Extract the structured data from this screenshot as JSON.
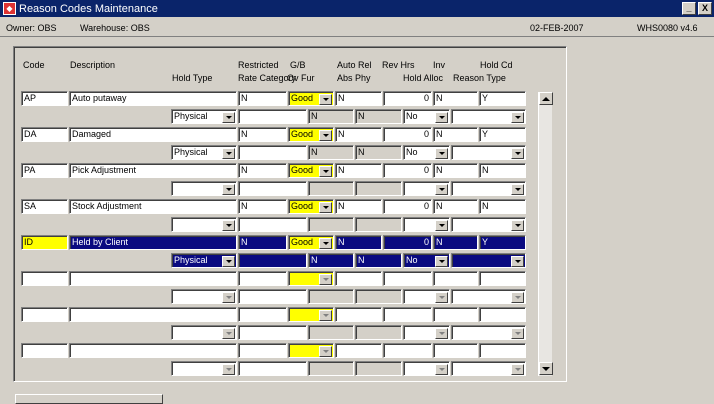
{
  "window": {
    "title": "Reason Codes Maintenance",
    "min_glyph": "_",
    "close_glyph": "X"
  },
  "info": {
    "owner": "Owner: OBS",
    "warehouse": "Warehouse: OBS",
    "date": "02-FEB-2007",
    "version": "WHS0080 v4.6"
  },
  "headers": {
    "code": "Code",
    "description": "Description",
    "hold_type": "Hold Type",
    "restricted_top": "Restricted",
    "restricted_bottom": "Rate Category",
    "gb_top": "G/B",
    "gb_bottom": "Ov Fur",
    "auto_rel_top": "Auto Rel",
    "auto_rel_bottom": "Abs Phy",
    "rev_hrs_top": "Rev Hrs",
    "rev_hrs_bottom": "Hold Alloc",
    "inv_top": "Inv",
    "inv_bottom": "Hold Cd",
    "hold_cd_top": "Hold Cd",
    "hold_cd_bottom": "Reason Type"
  },
  "rows": [
    {
      "code": "AP",
      "description": "Auto putaway",
      "restricted": "N",
      "gb": "Good",
      "auto_rel": "N",
      "rev_hrs": "0",
      "inv": "N",
      "hold_cd": "Y",
      "hold_type": "Physical",
      "ov_fur": "N",
      "abs_phy": "N",
      "hold_alloc": "No",
      "rate_category": "",
      "reason_type": ""
    },
    {
      "code": "DA",
      "description": "Damaged",
      "restricted": "N",
      "gb": "Good",
      "auto_rel": "N",
      "rev_hrs": "0",
      "inv": "N",
      "hold_cd": "Y",
      "hold_type": "Physical",
      "ov_fur": "N",
      "abs_phy": "N",
      "hold_alloc": "No",
      "rate_category": "",
      "reason_type": ""
    },
    {
      "code": "PA",
      "description": "Pick Adjustment",
      "restricted": "N",
      "gb": "Good",
      "auto_rel": "N",
      "rev_hrs": "0",
      "inv": "N",
      "hold_cd": "N",
      "hold_type": "",
      "ov_fur": "",
      "abs_phy": "",
      "hold_alloc": "",
      "rate_category": "",
      "reason_type": ""
    },
    {
      "code": "SA",
      "description": "Stock Adjustment",
      "restricted": "N",
      "gb": "Good",
      "auto_rel": "N",
      "rev_hrs": "0",
      "inv": "N",
      "hold_cd": "N",
      "hold_type": "",
      "ov_fur": "",
      "abs_phy": "",
      "hold_alloc": "",
      "rate_category": "",
      "reason_type": ""
    },
    {
      "code": "ID",
      "description": "Held by Client",
      "restricted": "N",
      "gb": "Good",
      "auto_rel": "N",
      "rev_hrs": "0",
      "inv": "N",
      "hold_cd": "Y",
      "hold_type": "Physical",
      "ov_fur": "N",
      "abs_phy": "N",
      "hold_alloc": "No",
      "rate_category": "",
      "reason_type": ""
    },
    {
      "code": "",
      "description": "",
      "restricted": "",
      "gb": "",
      "auto_rel": "",
      "rev_hrs": "",
      "inv": "",
      "hold_cd": "",
      "hold_type": "",
      "ov_fur": "",
      "abs_phy": "",
      "hold_alloc": "",
      "rate_category": "",
      "reason_type": ""
    },
    {
      "code": "",
      "description": "",
      "restricted": "",
      "gb": "",
      "auto_rel": "",
      "rev_hrs": "",
      "inv": "",
      "hold_cd": "",
      "hold_type": "",
      "ov_fur": "",
      "abs_phy": "",
      "hold_alloc": "",
      "rate_category": "",
      "reason_type": ""
    },
    {
      "code": "",
      "description": "",
      "restricted": "",
      "gb": "",
      "auto_rel": "",
      "rev_hrs": "",
      "inv": "",
      "hold_cd": "",
      "hold_type": "",
      "ov_fur": "",
      "abs_phy": "",
      "hold_alloc": "",
      "rate_category": "",
      "reason_type": ""
    }
  ],
  "colors": {
    "title_bar": "#0a246a",
    "selected_row": "#0a0a80",
    "highlight": "#ffff00",
    "window_bg": "#d4d0c8"
  }
}
